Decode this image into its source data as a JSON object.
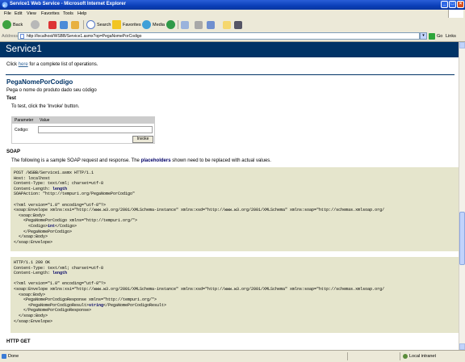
{
  "window": {
    "title": "Service1 Web Service - Microsoft Internet Explorer"
  },
  "menu": [
    "File",
    "Edit",
    "View",
    "Favorites",
    "Tools",
    "Help"
  ],
  "toolbar": {
    "back": "Back",
    "search": "Search",
    "favorites": "Favorites",
    "media": "Media"
  },
  "address": {
    "label": "Address",
    "url": "http://localhost/WSBB/Service1.asmx?op=PegaNomePorCodigo",
    "go": "Go",
    "links": "Links"
  },
  "page": {
    "service_name": "Service1",
    "click_prefix": "Click ",
    "here_link": "here",
    "click_suffix": " for a complete list of operations.",
    "operation_title": "PegaNomePorCodigo",
    "operation_desc": "Pega o nome do produto dado seu código",
    "test_heading": "Test",
    "test_instruction": "To test, click the 'Invoke' button.",
    "param_col": "Parameter",
    "value_col": "Value",
    "param_name": "Codigo:",
    "codigo_value": "",
    "invoke_label": "Invoke",
    "soap_heading": "SOAP",
    "soap_desc_prefix": "The following is a sample SOAP request and response.  The ",
    "soap_desc_placeholders": "placeholders",
    "soap_desc_suffix": " shown need to be replaced with actual values.",
    "http_get_heading": "HTTP GET"
  },
  "soap_request": [
    "POST /WSBB/Service1.asmx HTTP/1.1",
    "Host: localhost",
    "Content-Type: text/xml; charset=utf-8",
    "Content-Length: |length|",
    "SOAPAction: \"http://tempuri.org/PegaNomePorCodigo\"",
    "",
    "<?xml version=\"1.0\" encoding=\"utf-8\"?>",
    "<soap:Envelope xmlns:xsi=\"http://www.w3.org/2001/XMLSchema-instance\" xmlns:xsd=\"http://www.w3.org/2001/XMLSchema\" xmlns:soap=\"http://schemas.xmlsoap.org/",
    "  <soap:Body>",
    "    <PegaNomePorCodigo xmlns=\"http://tempuri.org/\">",
    "      <Codigo>|int|</Codigo>",
    "    </PegaNomePorCodigo>",
    "  </soap:Body>",
    "</soap:Envelope>"
  ],
  "soap_response": [
    "HTTP/1.1 200 OK",
    "Content-Type: text/xml; charset=utf-8",
    "Content-Length: |length|",
    "",
    "<?xml version=\"1.0\" encoding=\"utf-8\"?>",
    "<soap:Envelope xmlns:xsi=\"http://www.w3.org/2001/XMLSchema-instance\" xmlns:xsd=\"http://www.w3.org/2001/XMLSchema\" xmlns:soap=\"http://schemas.xmlsoap.org/",
    "  <soap:Body>",
    "    <PegaNomePorCodigoResponse xmlns=\"http://tempuri.org/\">",
    "      <PegaNomePorCodigoResult>|string|</PegaNomePorCodigoResult>",
    "    </PegaNomePorCodigoResponse>",
    "  </soap:Body>",
    "</soap:Envelope>"
  ],
  "status": {
    "text": "Done",
    "zone": "Local intranet"
  },
  "colors": {
    "banner": "#003366",
    "code_bg": "#e5e5cc",
    "title_bar": "#0a3fb8"
  }
}
